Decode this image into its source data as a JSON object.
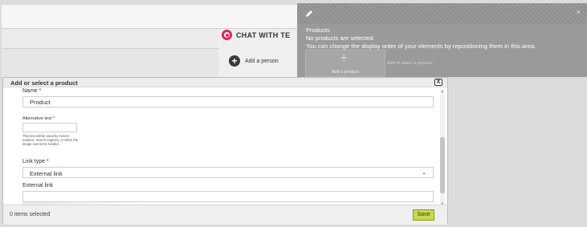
{
  "background": {
    "chat_title": "CHAT WITH TE",
    "add_person": "Add a person"
  },
  "right_panel": {
    "products_heading": "Products",
    "no_products": "No products are selected.",
    "hint": "You can change the display order of your elements by repositioning them in this area.",
    "add_product_label": "Add a product",
    "add_or_select": "Add or select a product",
    "close_symbol": "×"
  },
  "modal": {
    "title": "Add or select a product",
    "close_symbol": "X",
    "fields": {
      "name_label": "Name",
      "name_value": "Product",
      "alt_label": "Alternative text",
      "alt_value": "",
      "alt_help": "This text will be used by screen readers, search engines, or when the image cannot be loaded.",
      "link_type_label": "Link type",
      "link_type_value": "External link",
      "external_link_label": "External link",
      "external_link_value": ""
    },
    "required_marker": "*",
    "footer": {
      "items_selected": "0 items selected",
      "save_label": "Save"
    }
  },
  "colors": {
    "accent_save": "#c8d84a",
    "chat_icon": "#e0245e",
    "required": "#d6001c",
    "panel_grey": "#9a9a9a"
  },
  "icons": [
    "pencil-icon",
    "close-icon",
    "chat-icon",
    "add-person-icon",
    "plus-icon",
    "chevron-down-icon",
    "scroll-up-icon",
    "scroll-down-icon"
  ]
}
